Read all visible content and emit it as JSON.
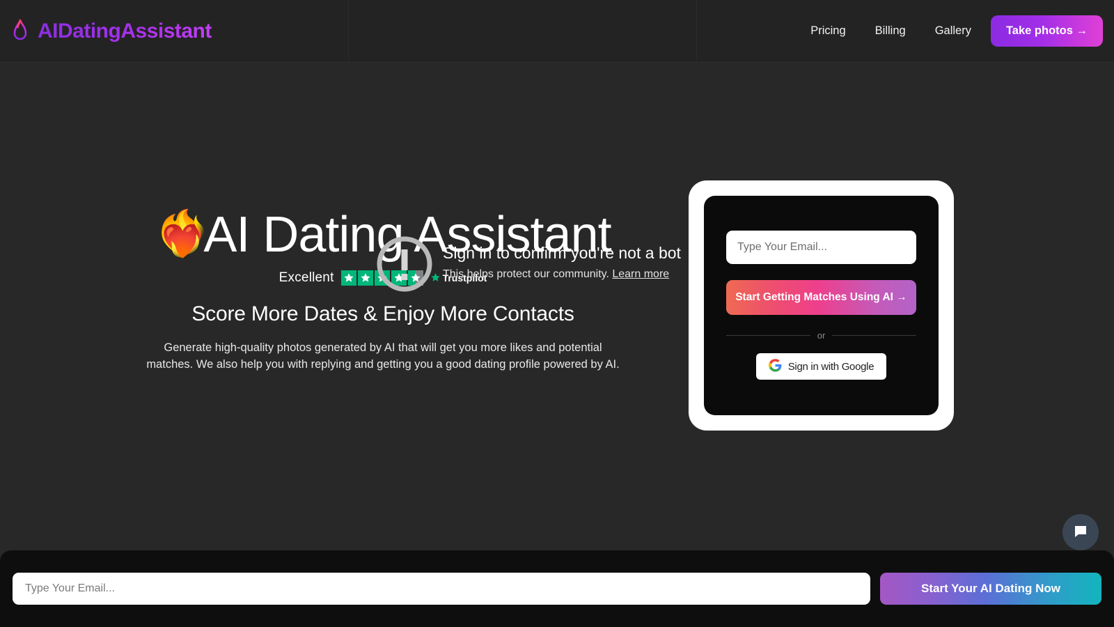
{
  "header": {
    "brand_name": "AIDatingAssistant",
    "brand_icon": "flame-icon",
    "nav": [
      {
        "label": "Pricing"
      },
      {
        "label": "Billing"
      },
      {
        "label": "Gallery"
      }
    ],
    "cta_label": "Take photos →",
    "cta_gradient_from": "#8b2be2",
    "cta_gradient_to": "#e040d6",
    "background": "#232323"
  },
  "hero": {
    "emoji": "❤️‍🔥",
    "emoji_name": "heart-on-fire-emoji",
    "title": "AI Dating Assistant",
    "subtitle": "Score More Dates & Enjoy More Contacts",
    "body": "Generate high-quality photos generated by AI that will get you more likes and potential matches. We also help you with replying and getting you a good dating profile powered by AI.",
    "trustpilot": {
      "rating_word": "Excellent",
      "stars_total": 5,
      "stars_filled": 4.5,
      "star_color": "#00b67a",
      "brand": "Trustpilot"
    }
  },
  "bot_check": {
    "icon": "exclamation-circle-icon",
    "title": "Sign in to confirm you're not a bot",
    "subtitle": "This helps protect our community.",
    "link_label": "Learn more"
  },
  "signup_card": {
    "email_placeholder": "Type Your Email...",
    "email_value": "",
    "primary_cta": "Start Getting Matches Using AI →",
    "primary_gradient_from": "#ef6a52",
    "primary_gradient_to": "#b363c9",
    "divider_label": "or",
    "google_label": "Sign in with Google",
    "google_icon": "google-g-icon"
  },
  "footer": {
    "email_placeholder": "Type Your Email...",
    "email_value": "",
    "cta_label": "Start Your AI Dating Now",
    "cta_gradient_from": "#a457c4",
    "cta_gradient_to": "#12b5bd",
    "chat_icon": "chat-bubble-icon",
    "chat_bg": "#3a4654"
  }
}
